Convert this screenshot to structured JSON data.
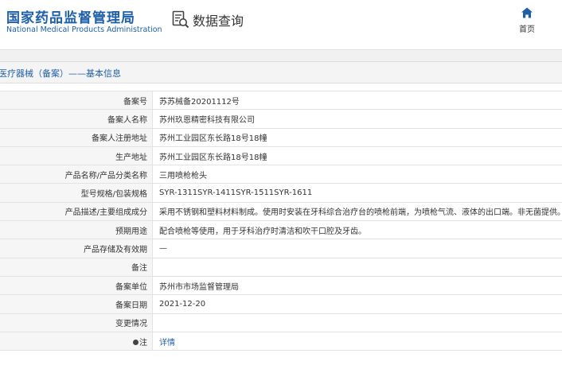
{
  "header": {
    "brand_cn": "国家药品监督管理局",
    "brand_en": "National Medical Products Administration",
    "query_label": "数据查询",
    "home_label": "首页",
    "right_edge_label": "",
    "icons": [
      "search-document-icon",
      "home-icon"
    ],
    "accent_color": "#1f5fa8"
  },
  "section": {
    "title": "医疗器械（备案）——基本信息"
  },
  "rows": [
    {
      "label": "备案号",
      "value": "苏苏械备20201112号"
    },
    {
      "label": "备案人名称",
      "value": "苏州玖恩精密科技有限公司"
    },
    {
      "label": "备案人注册地址",
      "value": "苏州工业园区东长路18号18幢"
    },
    {
      "label": "生产地址",
      "value": "苏州工业园区东长路18号18幢"
    },
    {
      "label": "产品名称/产品分类名称",
      "value": "三用喷枪枪头"
    },
    {
      "label": "型号规格/包装规格",
      "value": "SYR-1311SYR-1411SYR-1511SYR-1611"
    },
    {
      "label": "产品描述/主要组成成分",
      "value": "采用不锈钢和塑料材料制成。使用时安装在牙科综合治疗台的喷枪前端，为喷枪气流、液体的出口端。非无菌提供。"
    },
    {
      "label": "预期用途",
      "value": "配合喷枪等使用，用于牙科治疗时清洁和吹干口腔及牙齿。"
    },
    {
      "label": "产品存储及有效期",
      "value": "—"
    },
    {
      "label": "备注",
      "value": ""
    },
    {
      "label": "备案单位",
      "value": "苏州市市场监督管理局"
    },
    {
      "label": "备案日期",
      "value": "2021-12-20"
    },
    {
      "label": "变更情况",
      "value": ""
    }
  ],
  "note_row": {
    "label": "注",
    "link": "详情"
  }
}
